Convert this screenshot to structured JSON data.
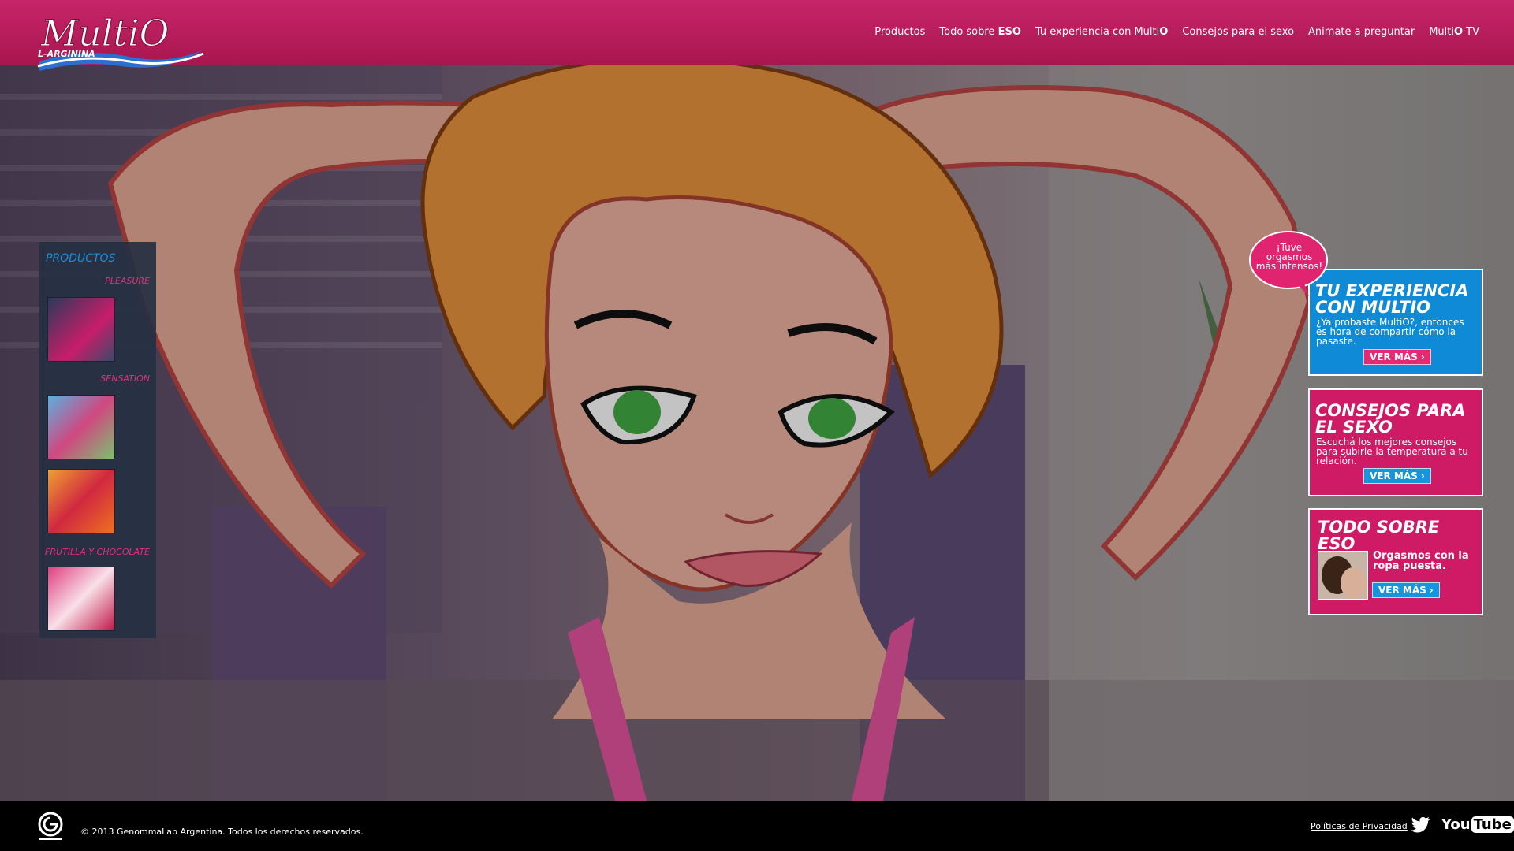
{
  "brand": {
    "name": "MultiO",
    "tagline": "L-ARGININA"
  },
  "nav": {
    "items": [
      {
        "label": "Productos"
      },
      {
        "label_prefix": "Todo sobre ",
        "label_bold": "ESO"
      },
      {
        "label_prefix": "Tu experiencia con Multi",
        "label_bold": "O"
      },
      {
        "label": "Consejos para el sexo"
      },
      {
        "label": "Animate a preguntar"
      },
      {
        "label_prefix": "Multi",
        "label_bold": "O",
        "label_suffix": " TV"
      }
    ]
  },
  "products": {
    "title": "PRODUCTOS",
    "categories": [
      {
        "name": "PLEASURE"
      },
      {
        "name": "SENSATION"
      },
      {
        "name": "FRUTILLA Y CHOCOLATE"
      }
    ]
  },
  "bubble": {
    "text": "¡Tuve orgasmos más intensos!"
  },
  "promos": {
    "experience": {
      "title": "TU EXPERIENCIA CON MULTIO",
      "desc": "¿Ya probaste MultiO?, entonces es hora de compartir cómo la pasaste.",
      "button": "VER MÁS"
    },
    "advice": {
      "title": "CONSEJOS PARA EL SEXO",
      "desc": "Escuchá los mejores consejos para subirle la temperatura a tu relación.",
      "button": "VER MÁS"
    },
    "about": {
      "title": "TODO SOBRE ESO",
      "subtitle": "Orgasmos con la ropa puesta.",
      "button": "VER MÁS"
    }
  },
  "footer": {
    "copyright": "© 2013 GenommaLab Argentina. Todos los derechos reservados.",
    "privacy": "Políticas de Privacidad",
    "youtube_you": "You",
    "youtube_tube": "Tube"
  },
  "colors": {
    "header": "#b81a5c",
    "accent_pink": "#cf1b66",
    "accent_blue": "#0f8ad6",
    "sidebar_bg": "#263042"
  }
}
